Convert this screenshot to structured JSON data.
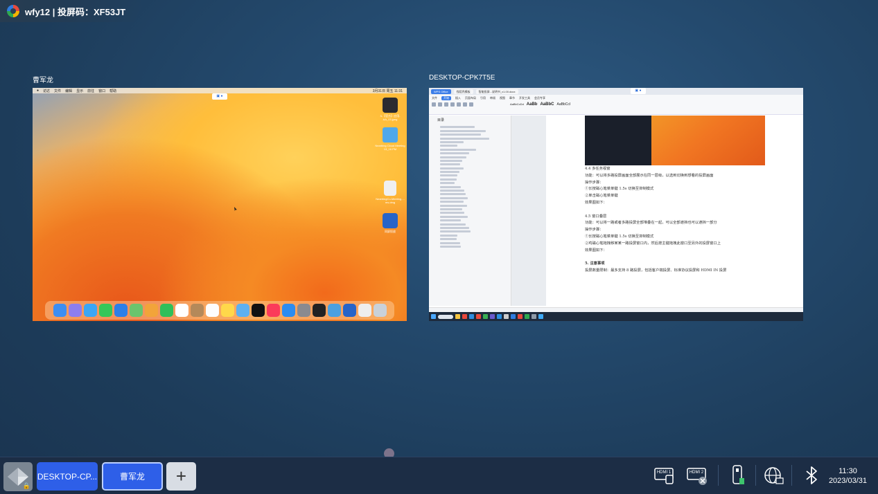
{
  "top_bar": {
    "title": "wfy12 | 投屏码：XF53JT"
  },
  "windows": [
    {
      "label": "曹军龙",
      "menubar": {
        "items": [
          "访达",
          "文件",
          "编辑",
          "显示",
          "前往",
          "窗口",
          "帮助"
        ],
        "datetime": "3月31日 周五 11:31"
      },
      "desktop_icons": [
        {
          "name": "monitor",
          "label": "3-【官方】应用-AA_03.jpeg"
        },
        {
          "name": "folder",
          "label": "Nearbing Cloud Meeting 13_16 PM"
        },
        {
          "name": "document",
          "label": "NearbingCo-Meeting...-ms.dmg"
        },
        {
          "name": "app",
          "label": "同屏投放"
        }
      ]
    },
    {
      "label": "DESKTOP-CPK7T5E",
      "tabs": [
        "WPS Office",
        "找稻壳模板",
        "智能投屏...说明书_v1.00.docx"
      ],
      "ribbon_menu": [
        "文件",
        "开始",
        "插入",
        "页面布局",
        "引用",
        "审阅",
        "视图",
        "章节",
        "开发工具",
        "会员专享"
      ],
      "style_samples": [
        "AaBbCcDd",
        "AaBb",
        "AaBbC",
        "AaBbCcI"
      ],
      "toc_title": "目录",
      "doc_lines": [
        {
          "text": "4.4 多任务视窗",
          "bold": false
        },
        {
          "text": "功能：可以将多路投屏画面全部展示在同一层级，以选到切换到想看的投屏画面",
          "bold": false
        },
        {
          "text": "操作步骤：",
          "bold": false
        },
        {
          "text": "①长按磁心笔菜单键 1.5s 切换至抑制模式",
          "bold": false
        },
        {
          "text": "②单击磁心笔菜单键",
          "bold": false
        },
        {
          "text": "效果图如下：",
          "bold": false
        },
        {
          "text": "",
          "bold": false
        },
        {
          "text": "4.5 窗口叠层",
          "bold": false
        },
        {
          "text": "功能：可以将一路或者多路投屏全部堆叠在一起，可以全部遮挡也可以遮挡一部分",
          "bold": false
        },
        {
          "text": "操作步骤：",
          "bold": false
        },
        {
          "text": "①长按磁心笔菜单键 1.5s 切换至抑制模式",
          "bold": false
        },
        {
          "text": "②鸡磁心笔拖拽移某某一路投屏窗口内，然后按主键拖拽此窗口至另外的投屏窗口上",
          "bold": false
        },
        {
          "text": "效果图如下：",
          "bold": false
        },
        {
          "text": "",
          "bold": false
        },
        {
          "text": "5. 注意事项",
          "bold": true
        },
        {
          "text": "投屏数量限制：最多支持 8 路投屏，包括客户端投屏、标准协议投屏和 HDMI IN 投屏",
          "bold": false
        }
      ]
    }
  ],
  "bottom_bar": {
    "tabs": [
      {
        "label": "DESKTOP-CP...",
        "active": false
      },
      {
        "label": "曹军龙",
        "active": true
      }
    ],
    "add_label": "+",
    "icons": [
      "hdmi1-icon",
      "hdmi2-icon",
      "usb-dongle-icon",
      "network-icon",
      "bluetooth-icon"
    ],
    "hdmi1": "HDMI 1",
    "hdmi2": "HDMI 2",
    "time": "11:30",
    "date": "2023/03/31"
  },
  "colors": {
    "accent": "#2e5fe8",
    "bar_bg": "#1c2d45"
  }
}
